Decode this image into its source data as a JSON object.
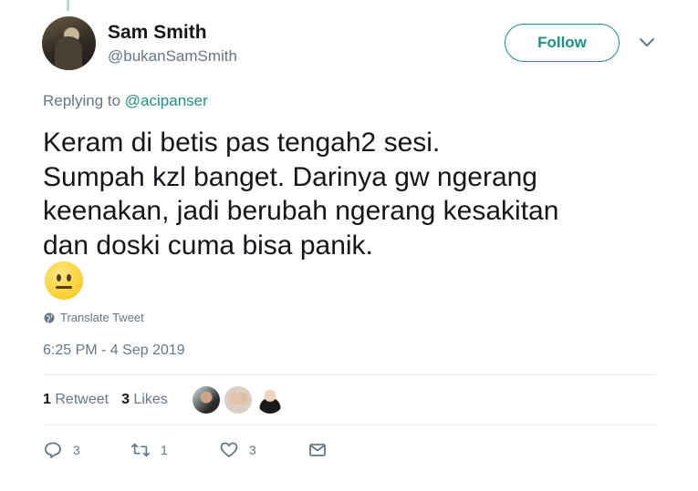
{
  "author": {
    "name": "Sam Smith",
    "handle": "@bukanSamSmith"
  },
  "follow_button": {
    "label": "Follow"
  },
  "reply_context": {
    "prefix": "Replying to",
    "mention": "@acipanser"
  },
  "tweet": {
    "lines": [
      "Keram di betis pas tengah2 sesi.",
      "Sumpah kzl banget. Darinya gw ngerang",
      "keenakan, jadi berubah ngerang kesakitan",
      "dan doski cuma bisa panik."
    ],
    "emoji": "neutral-face-emoji"
  },
  "translate": {
    "label": "Translate Tweet"
  },
  "timestamp": "6:25 PM - 4 Sep 2019",
  "stats": {
    "retweet_count": "1",
    "retweet_label": "Retweet",
    "like_count": "3",
    "like_label": "Likes"
  },
  "actions": {
    "reply_count": "3",
    "retweet_count": "1",
    "like_count": "3"
  },
  "colors": {
    "accent": "#1b9384",
    "text_primary": "#14171a",
    "text_secondary": "#657786",
    "divider": "#e6ecf0"
  }
}
